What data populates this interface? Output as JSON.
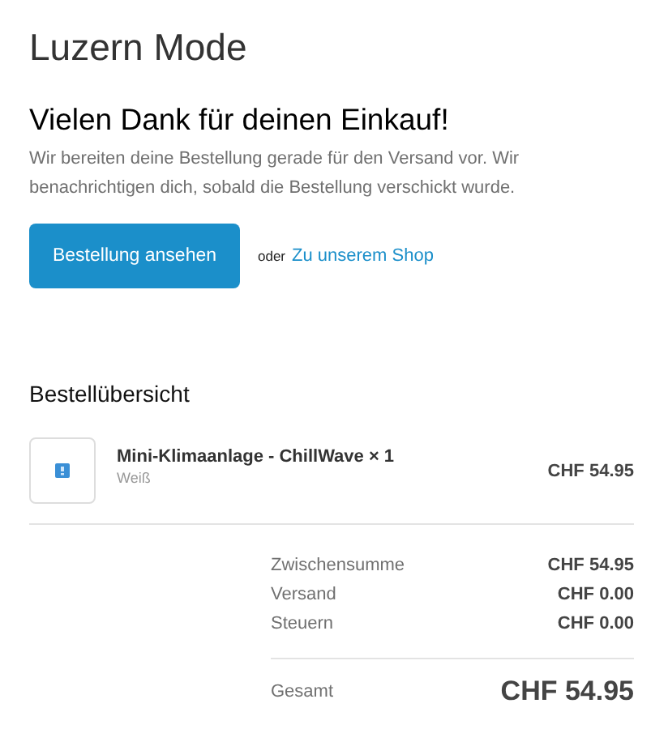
{
  "shop_name": "Luzern Mode",
  "heading": "Vielen Dank für deinen Einkauf!",
  "message": "Wir bereiten deine Bestellung gerade für den Versand vor. Wir benachrichtigen dich, sobald die Bestellung verschickt wurde.",
  "primary_button": "Bestellung ansehen",
  "or_text": "oder",
  "shop_link": "Zu unserem Shop",
  "summary": {
    "title": "Bestellübersicht",
    "items": [
      {
        "name": "Mini-Klimaanlage - ChillWave × 1",
        "variant": "Weiß",
        "price": "CHF 54.95"
      }
    ],
    "lines": [
      {
        "label": "Zwischensumme",
        "value": "CHF 54.95"
      },
      {
        "label": "Versand",
        "value": "CHF 0.00"
      },
      {
        "label": "Steuern",
        "value": "CHF 0.00"
      }
    ],
    "total": {
      "label": "Gesamt",
      "value": "CHF 54.95"
    }
  }
}
